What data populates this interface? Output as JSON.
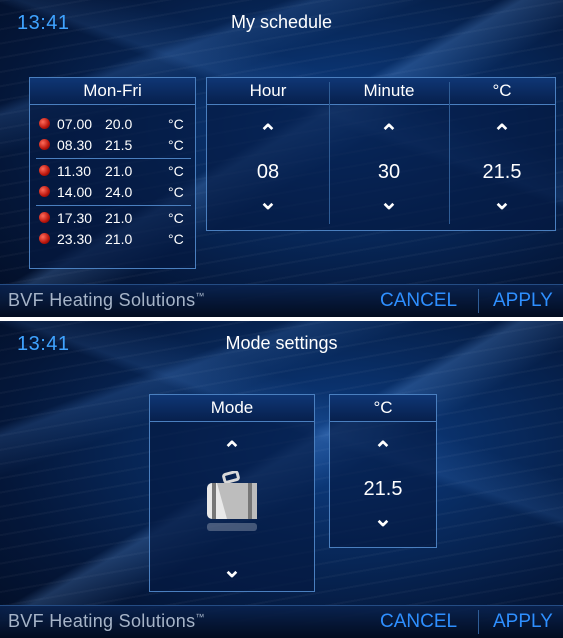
{
  "top_screen": {
    "time": "13:41",
    "title": "My schedule",
    "schedule": {
      "header": "Mon-Fri",
      "groups": [
        [
          {
            "time": "07.00",
            "temp": "20.0",
            "unit": "°C"
          },
          {
            "time": "08.30",
            "temp": "21.5",
            "unit": "°C"
          }
        ],
        [
          {
            "time": "11.30",
            "temp": "21.0",
            "unit": "°C"
          },
          {
            "time": "14.00",
            "temp": "24.0",
            "unit": "°C"
          }
        ],
        [
          {
            "time": "17.30",
            "temp": "21.0",
            "unit": "°C"
          },
          {
            "time": "23.30",
            "temp": "21.0",
            "unit": "°C"
          }
        ]
      ]
    },
    "editor": {
      "hour": {
        "label": "Hour",
        "value": "08"
      },
      "minute": {
        "label": "Minute",
        "value": "30"
      },
      "temp": {
        "label": "°C",
        "value": "21.5"
      }
    },
    "footer": {
      "brand": "BVF Heating Solutions",
      "trademark": "™",
      "cancel": "CANCEL",
      "apply": "APPLY"
    }
  },
  "bottom_screen": {
    "time": "13:41",
    "title": "Mode settings",
    "mode": {
      "label": "Mode",
      "icon": "suitcase-icon"
    },
    "temp": {
      "label": "°C",
      "value": "21.5"
    },
    "footer": {
      "brand": "BVF Heating Solutions",
      "trademark": "™",
      "cancel": "CANCEL",
      "apply": "APPLY"
    }
  },
  "colors": {
    "accent": "#2e8fff",
    "time": "#3fa3ff",
    "dot": "#c0170c",
    "panel_border": "#4a7fbf"
  }
}
